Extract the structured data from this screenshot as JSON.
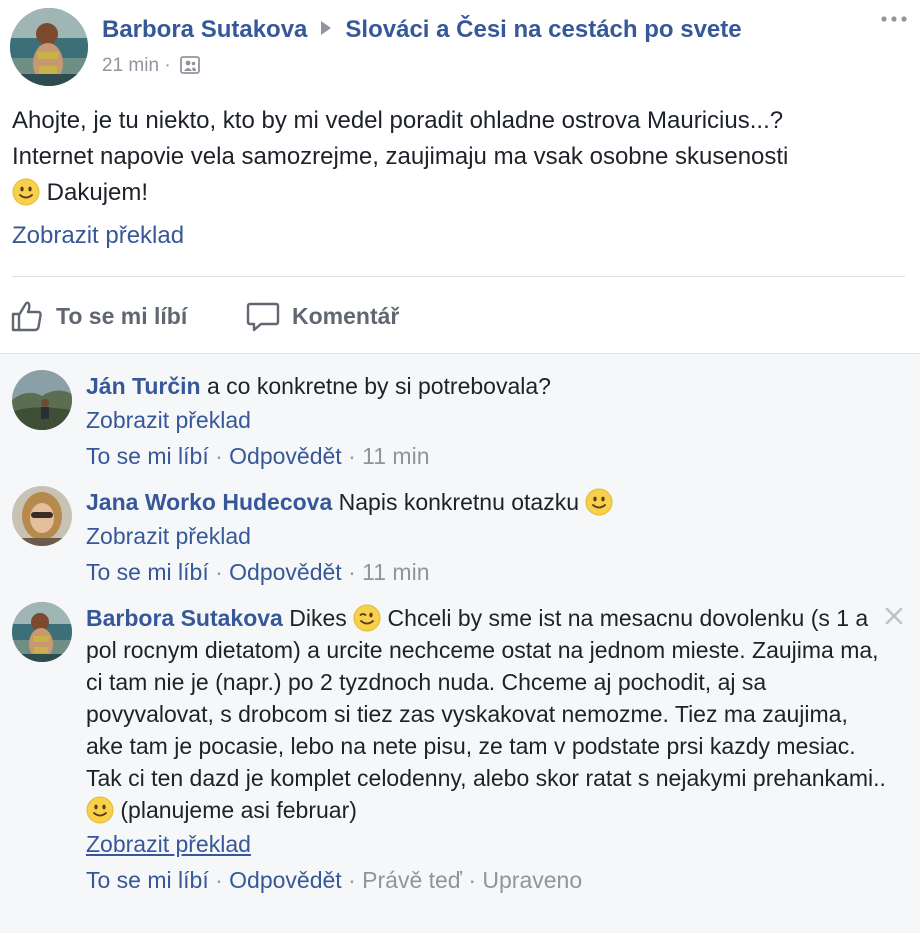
{
  "post": {
    "author": "Barbora Sutakova",
    "group": "Slováci a Česi na cestách po svete",
    "time": "21 min",
    "separator": "·",
    "audience_icon": "group-members-icon",
    "body_line1": "Ahojte, je tu niekto, kto by mi vedel poradit ohladne ostrova Mauricius...?",
    "body_line2": "Internet napovie vela samozrejme, zaujimaju ma vsak osobne skusenosti",
    "body_line3": "Dakujem!",
    "translate_label": "Zobrazit překlad",
    "like_label": "To se mi líbí",
    "comment_label": "Komentář"
  },
  "comments": [
    {
      "author": "Ján Turčin",
      "text": "a co konkretne by si potrebovala?",
      "translate": "Zobrazit překlad",
      "like": "To se mi líbí",
      "reply": "Odpovědět",
      "time": "11 min",
      "dot": "·"
    },
    {
      "author": "Jana Worko Hudecova",
      "text": "Napis konkretnu otazku",
      "translate": "Zobrazit překlad",
      "like": "To se mi líbí",
      "reply": "Odpovědět",
      "time": "11 min",
      "dot": "·"
    },
    {
      "author": "Barbora Sutakova",
      "text_a": "Dikes",
      "text_b": "Chceli by sme ist na mesacnu dovolenku (s 1 a pol rocnym dietatom) a urcite nechceme ostat na jednom mieste. Zaujima ma, ci tam nie je (napr.) po 2 tyzdnoch nuda. Chceme aj pochodit, aj sa povyvalovat, s drobcom si tiez zas vyskakovat nemozme. Tiez ma zaujima, ake tam je pocasie, lebo na nete pisu, ze tam v podstate prsi kazdy mesiac. Tak ci ten dazd je komplet celodenny, alebo skor ratat s nejakymi prehankami..",
      "text_c": "(planujeme asi februar)",
      "translate": "Zobrazit překlad",
      "like": "To se mi líbí",
      "reply": "Odpovědět",
      "time": "Právě teď",
      "edited": "Upraveno",
      "dot": "·"
    }
  ],
  "colors": {
    "link": "#365899",
    "meta": "#90949c",
    "text": "#1d2129",
    "comments_bg": "#f6f7f9"
  }
}
